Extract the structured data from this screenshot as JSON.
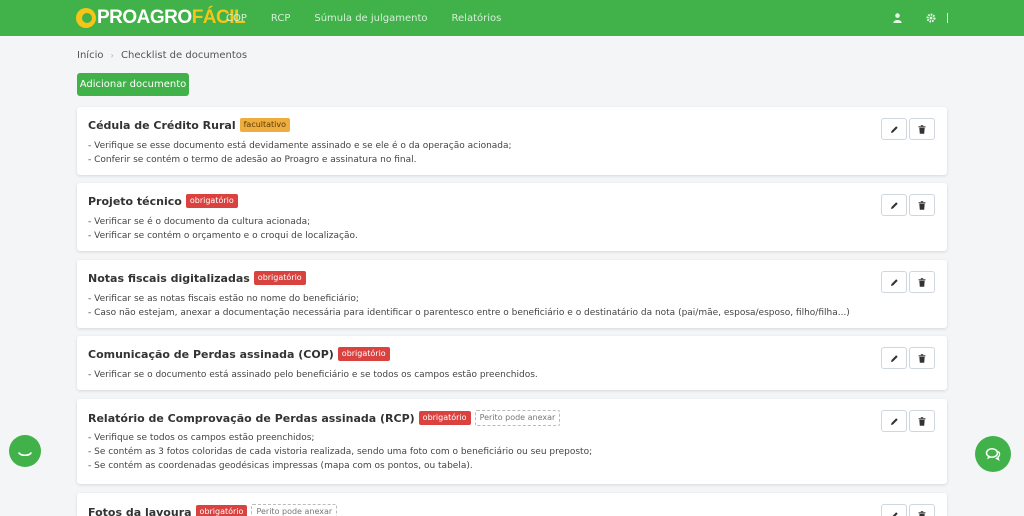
{
  "brand": {
    "logo_part1": "PROAGRO",
    "logo_part2": "FÁCIL"
  },
  "nav": {
    "items": [
      "COP",
      "RCP",
      "Súmula de julgamento",
      "Relatórios"
    ]
  },
  "top_icons": [
    "user-icon",
    "gear-icon"
  ],
  "breadcrumb": {
    "home": "Início",
    "separator": "›",
    "current": "Checklist de documentos"
  },
  "add_button": "Adicionar documento",
  "colors": {
    "primary": "#41b14a",
    "optional_badge": "#f0ad3f",
    "required_badge": "#d9423f"
  },
  "documents": [
    {
      "title": "Cédula de Crédito Rural",
      "badge": "facultativo",
      "lines": [
        "- Verifique se esse documento está devidamente assinado e se ele é o da operação acionada;",
        "- Conferir se contém o termo de adesão ao Proagro e assinatura no final."
      ]
    },
    {
      "title": "Projeto técnico",
      "badge": "obrigatório",
      "lines": [
        "- Verificar se é o documento da cultura acionada;",
        "- Verificar se contém o orçamento e o croqui de localização."
      ]
    },
    {
      "title": "Notas fiscais digitalizadas",
      "badge": "obrigatório",
      "lines": [
        "- Verificar se as notas fiscais estão no nome do beneficiário;",
        "- Caso não estejam, anexar a documentação necessária para identificar o parentesco entre o beneficiário e o destinatário da nota (pai/mãe, esposa/esposo, filho/filha...)"
      ]
    },
    {
      "title": "Comunicação de Perdas assinada (COP)",
      "badge": "obrigatório",
      "lines": [
        "- Verificar se o documento está assinado pelo beneficiário e se todos os campos estão preenchidos."
      ]
    },
    {
      "title": "Relatório de Comprovação de Perdas assinada (RCP)",
      "badge": "obrigatório",
      "extra_badge": "Perito pode anexar",
      "lines": [
        "- Verifique se todos os campos estão preenchidos;",
        "- Se contém as 3 fotos coloridas de cada vistoria realizada, sendo uma foto com o beneficiário ou seu preposto;",
        "- Se contém as coordenadas geodésicas impressas (mapa com os pontos, ou tabela)."
      ]
    },
    {
      "title": "Fotos da lavoura",
      "badge": "obrigatório",
      "extra_badge": "Perito pode anexar",
      "lines": []
    }
  ]
}
